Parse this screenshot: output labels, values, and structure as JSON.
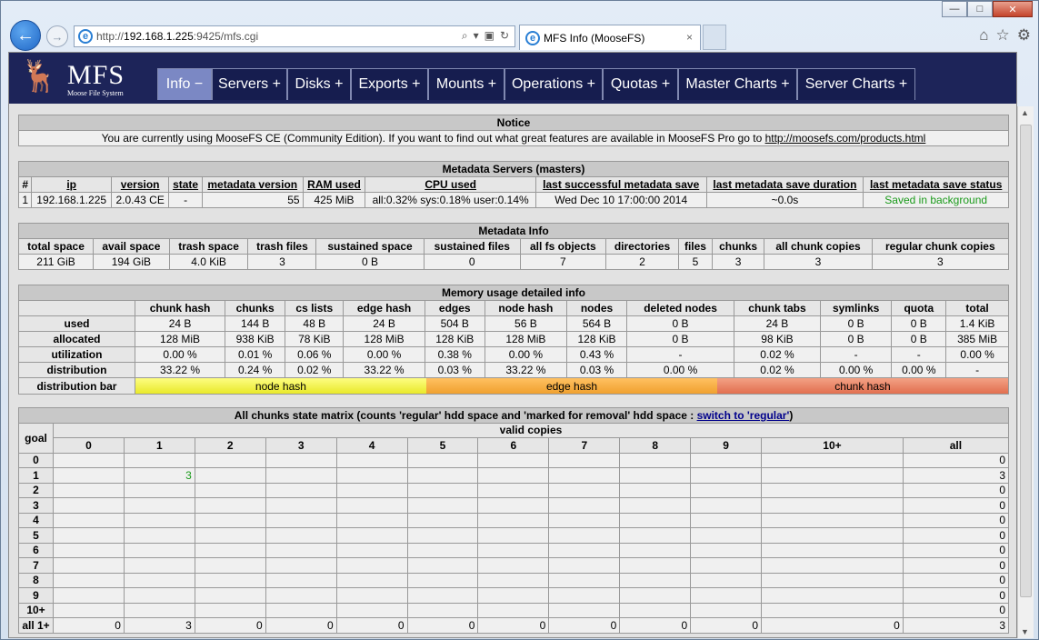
{
  "browser": {
    "back_glyph": "←",
    "forward_glyph": "→",
    "url_prefix": "http://",
    "url_host": "192.168.1.225",
    "url_rest": ":9425/mfs.cgi",
    "search_glyph": "⌕",
    "tab_title": "MFS Info (MooseFS)",
    "tab_close": "×",
    "min": "—",
    "max": "□",
    "close": "✕",
    "home_glyph": "⌂",
    "star_glyph": "☆",
    "gear_glyph": "⚙"
  },
  "logo": {
    "glyph": "🦌",
    "title": "MFS",
    "subtitle": "Moose File System"
  },
  "menu": [
    {
      "label": "Info −"
    },
    {
      "label": "Servers +"
    },
    {
      "label": "Disks +"
    },
    {
      "label": "Exports +"
    },
    {
      "label": "Mounts +"
    },
    {
      "label": "Operations +"
    },
    {
      "label": "Quotas +"
    },
    {
      "label": "Master Charts +"
    },
    {
      "label": "Server Charts +"
    }
  ],
  "notice": {
    "title": "Notice",
    "text": "You are currently using MooseFS CE (Community Edition). If you want to find out what great features are available in MooseFS Pro go to ",
    "link": "http://moosefs.com/products.html"
  },
  "masters": {
    "title": "Metadata Servers (masters)",
    "headers": [
      "#",
      "ip",
      "version",
      "state",
      "metadata version",
      "RAM used",
      "CPU used",
      "last successful metadata save",
      "last metadata save duration",
      "last metadata save status"
    ],
    "row": [
      "1",
      "192.168.1.225",
      "2.0.43 CE",
      "-",
      "55",
      "425 MiB",
      "all:0.32% sys:0.18% user:0.14%",
      "Wed Dec 10 17:00:00 2014",
      "~0.0s",
      "Saved in background"
    ]
  },
  "metainfo": {
    "title": "Metadata Info",
    "headers": [
      "total space",
      "avail space",
      "trash space",
      "trash files",
      "sustained space",
      "sustained files",
      "all fs objects",
      "directories",
      "files",
      "chunks",
      "all chunk copies",
      "regular chunk copies"
    ],
    "row": [
      "211 GiB",
      "194 GiB",
      "4.0 KiB",
      "3",
      "0 B",
      "0",
      "7",
      "2",
      "5",
      "3",
      "3",
      "3"
    ]
  },
  "memory": {
    "title": "Memory usage detailed info",
    "headers": [
      "chunk hash",
      "chunks",
      "cs lists",
      "edge hash",
      "edges",
      "node hash",
      "nodes",
      "deleted nodes",
      "chunk tabs",
      "symlinks",
      "quota",
      "total"
    ],
    "rows": [
      {
        "label": "used",
        "cells": [
          "24 B",
          "144 B",
          "48 B",
          "24 B",
          "504 B",
          "56 B",
          "564 B",
          "0 B",
          "24 B",
          "0 B",
          "0 B",
          "1.4 KiB"
        ]
      },
      {
        "label": "allocated",
        "cells": [
          "128 MiB",
          "938 KiB",
          "78 KiB",
          "128 MiB",
          "128 KiB",
          "128 MiB",
          "128 KiB",
          "0 B",
          "98 KiB",
          "0 B",
          "0 B",
          "385 MiB"
        ]
      },
      {
        "label": "utilization",
        "cells": [
          "0.00 %",
          "0.01 %",
          "0.06 %",
          "0.00 %",
          "0.38 %",
          "0.00 %",
          "0.43 %",
          "-",
          "0.02 %",
          "-",
          "-",
          "0.00 %"
        ]
      },
      {
        "label": "distribution",
        "cells": [
          "33.22 %",
          "0.24 %",
          "0.02 %",
          "33.22 %",
          "0.03 %",
          "33.22 %",
          "0.03 %",
          "0.00 %",
          "0.02 %",
          "0.00 %",
          "0.00 %",
          "-"
        ]
      }
    ],
    "bar_label": "distribution bar",
    "bar": [
      {
        "label": "node hash",
        "share": 33.22,
        "color": "#f4f454"
      },
      {
        "label": "edge hash",
        "share": 33.22,
        "color": "#f5b04a"
      },
      {
        "label": "chunk hash",
        "share": 33.22,
        "color": "#ea8a6a"
      }
    ]
  },
  "matrix": {
    "title": "All chunks state matrix (counts 'regular' hdd space and 'marked for removal' hdd space : ",
    "switch_link": "switch to 'regular'",
    "title_end": ")",
    "goal_label": "goal",
    "valid_label": "valid copies",
    "cols": [
      "0",
      "1",
      "2",
      "3",
      "4",
      "5",
      "6",
      "7",
      "8",
      "9",
      "10+",
      "all"
    ],
    "rows": [
      {
        "goal": "0",
        "cells": [
          "",
          "",
          "",
          "",
          "",
          "",
          "",
          "",
          "",
          "",
          "",
          "0"
        ]
      },
      {
        "goal": "1",
        "cells": [
          "",
          "3",
          "",
          "",
          "",
          "",
          "",
          "",
          "",
          "",
          "",
          "3"
        ]
      },
      {
        "goal": "2",
        "cells": [
          "",
          "",
          "",
          "",
          "",
          "",
          "",
          "",
          "",
          "",
          "",
          "0"
        ]
      },
      {
        "goal": "3",
        "cells": [
          "",
          "",
          "",
          "",
          "",
          "",
          "",
          "",
          "",
          "",
          "",
          "0"
        ]
      },
      {
        "goal": "4",
        "cells": [
          "",
          "",
          "",
          "",
          "",
          "",
          "",
          "",
          "",
          "",
          "",
          "0"
        ]
      },
      {
        "goal": "5",
        "cells": [
          "",
          "",
          "",
          "",
          "",
          "",
          "",
          "",
          "",
          "",
          "",
          "0"
        ]
      },
      {
        "goal": "6",
        "cells": [
          "",
          "",
          "",
          "",
          "",
          "",
          "",
          "",
          "",
          "",
          "",
          "0"
        ]
      },
      {
        "goal": "7",
        "cells": [
          "",
          "",
          "",
          "",
          "",
          "",
          "",
          "",
          "",
          "",
          "",
          "0"
        ]
      },
      {
        "goal": "8",
        "cells": [
          "",
          "",
          "",
          "",
          "",
          "",
          "",
          "",
          "",
          "",
          "",
          "0"
        ]
      },
      {
        "goal": "9",
        "cells": [
          "",
          "",
          "",
          "",
          "",
          "",
          "",
          "",
          "",
          "",
          "",
          "0"
        ]
      },
      {
        "goal": "10+",
        "cells": [
          "",
          "",
          "",
          "",
          "",
          "",
          "",
          "",
          "",
          "",
          "",
          "0"
        ]
      },
      {
        "goal": "all 1+",
        "cells": [
          "0",
          "3",
          "0",
          "0",
          "0",
          "0",
          "0",
          "0",
          "0",
          "0",
          "0",
          "3"
        ]
      }
    ]
  }
}
